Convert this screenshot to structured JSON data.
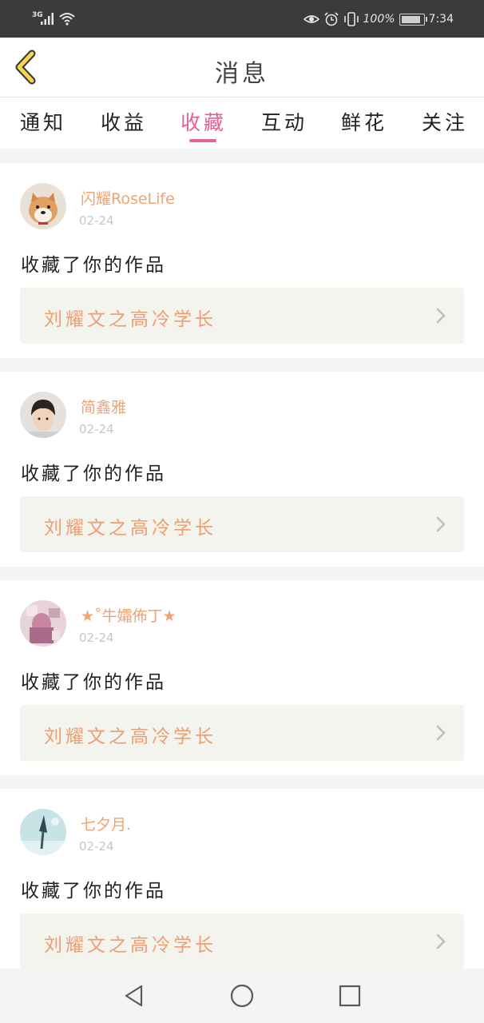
{
  "status_bar": {
    "network": "3G",
    "battery": "100%",
    "battery_level": 0.9,
    "time": "7:34"
  },
  "header": {
    "title": "消息",
    "back_icon": "back-chevron-icon"
  },
  "tabs": [
    {
      "label": "通知",
      "active": false
    },
    {
      "label": "收益",
      "active": false
    },
    {
      "label": "收藏",
      "active": true
    },
    {
      "label": "互动",
      "active": false
    },
    {
      "label": "鲜花",
      "active": false
    },
    {
      "label": "关注",
      "active": false
    }
  ],
  "messages": [
    {
      "user": "闪耀RoseLife",
      "date": "02-24",
      "action": "收藏了你的作品",
      "work": "刘耀文之高冷学长"
    },
    {
      "user": "简鑫雅",
      "date": "02-24",
      "action": "收藏了你的作品",
      "work": "刘耀文之高冷学长"
    },
    {
      "user": "★˚牛孀佈丁★",
      "date": "02-24",
      "action": "收藏了你的作品",
      "work": "刘耀文之高冷学长"
    },
    {
      "user": "七夕月.",
      "date": "02-24",
      "action": "收藏了你的作品",
      "work": "刘耀文之高冷学长"
    }
  ],
  "colors": {
    "accent": "#e85d95",
    "username": "#f0a372",
    "work_title": "#ee9e73",
    "status_bar": "#3b3b3b"
  },
  "nav": {
    "back_icon": "triangle-back-icon",
    "home_icon": "circle-home-icon",
    "recents_icon": "square-recents-icon"
  }
}
